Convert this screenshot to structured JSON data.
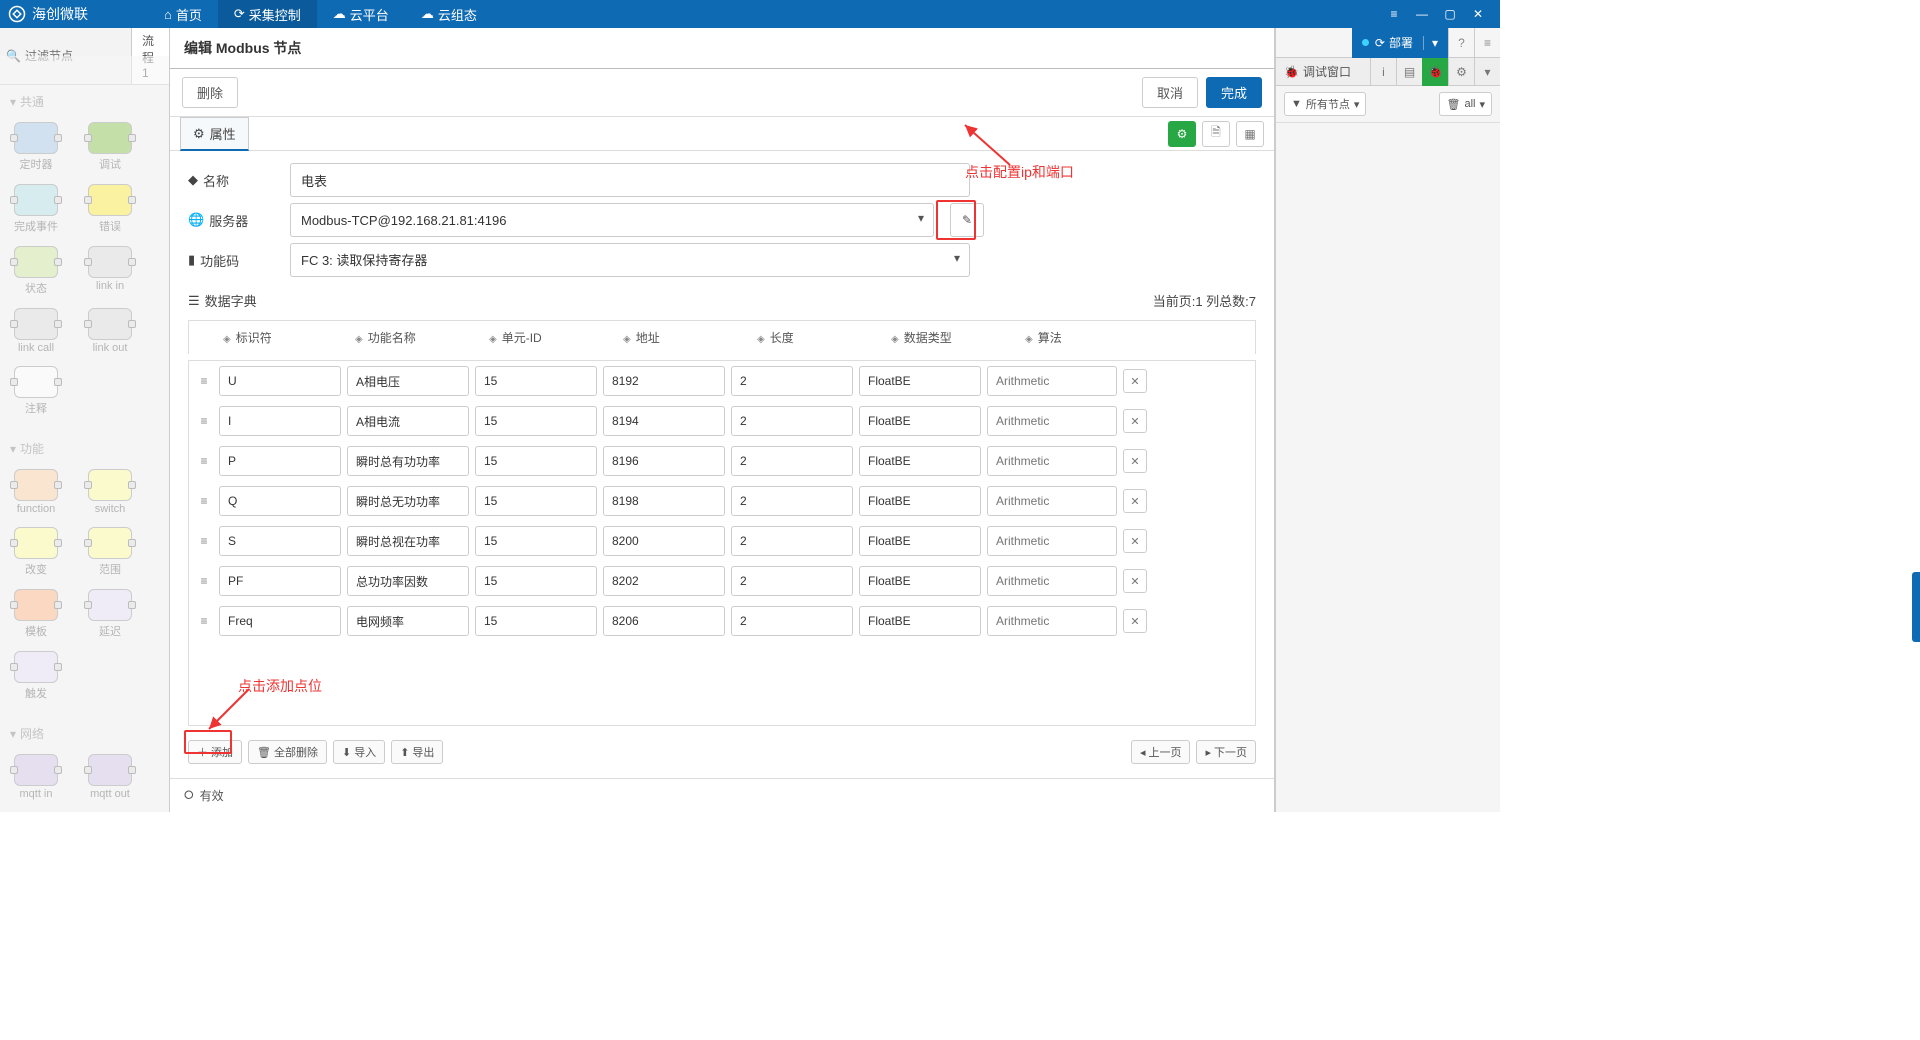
{
  "app_name": "海创微联",
  "top_nav": {
    "home": "首页",
    "collect": "采集控制",
    "cloud_platform": "云平台",
    "cloud_config": "云组态"
  },
  "palette": {
    "filter_placeholder": "过滤节点",
    "flow_tab": "流程1",
    "group_common": "共通",
    "group_function": "功能",
    "group_network": "网络",
    "nodes_common": [
      "定时器",
      "调试",
      "完成事件",
      "错误",
      "状态",
      "link in",
      "link call",
      "link out",
      "注释"
    ],
    "nodes_function": [
      "function",
      "switch",
      "改变",
      "范围",
      "模板",
      "延迟",
      "触发"
    ],
    "nodes_network": [
      "mqtt in",
      "mqtt out"
    ]
  },
  "editor": {
    "title": "编辑 Modbus 节点",
    "delete": "删除",
    "cancel": "取消",
    "done": "完成",
    "tab_props": "属性",
    "label_name": "名称",
    "name_value": "电表",
    "label_server": "服务器",
    "server_value": "Modbus-TCP@192.168.21.81:4196",
    "label_funccode": "功能码",
    "funccode_value": "FC 3: 读取保持寄存器",
    "dict_title": "数据字典",
    "page_info": "当前页:1  列总数:7",
    "columns": {
      "id": "标识符",
      "fn": "功能名称",
      "uid": "单元-ID",
      "addr": "地址",
      "len": "长度",
      "dtype": "数据类型",
      "alg": "算法"
    },
    "alg_placeholder": "Arithmetic",
    "rows": [
      {
        "id": "U",
        "fn": "A相电压",
        "uid": "15",
        "addr": "8192",
        "len": "2",
        "dtype": "FloatBE"
      },
      {
        "id": "I",
        "fn": "A相电流",
        "uid": "15",
        "addr": "8194",
        "len": "2",
        "dtype": "FloatBE"
      },
      {
        "id": "P",
        "fn": "瞬时总有功功率",
        "uid": "15",
        "addr": "8196",
        "len": "2",
        "dtype": "FloatBE"
      },
      {
        "id": "Q",
        "fn": "瞬时总无功功率",
        "uid": "15",
        "addr": "8198",
        "len": "2",
        "dtype": "FloatBE"
      },
      {
        "id": "S",
        "fn": "瞬时总视在功率",
        "uid": "15",
        "addr": "8200",
        "len": "2",
        "dtype": "FloatBE"
      },
      {
        "id": "PF",
        "fn": "总功功率因数",
        "uid": "15",
        "addr": "8202",
        "len": "2",
        "dtype": "FloatBE"
      },
      {
        "id": "Freq",
        "fn": "电网频率",
        "uid": "15",
        "addr": "8206",
        "len": "2",
        "dtype": "FloatBE"
      }
    ],
    "btn_add": "添加",
    "btn_delete_all": "全部删除",
    "btn_import": "导入",
    "btn_export": "导出",
    "btn_prev": "上一页",
    "btn_next": "下一页",
    "footer_valid": "有效"
  },
  "annotations": {
    "config_ip": "点击配置ip和端口",
    "add_point": "点击添加点位"
  },
  "sidebar": {
    "deploy": "部署",
    "debug_panel": "调试窗口",
    "filter_nodes": "所有节点",
    "filter_all": "all"
  },
  "node_colors": {
    "定时器": "#a7c7e7",
    "调试": "#8bc34a",
    "完成事件": "#b0e0e6",
    "错误": "#ffeb3b",
    "状态": "#cde69c",
    "link in": "#dcdcdc",
    "link call": "#dcdcdc",
    "link out": "#dcdcdc",
    "注释": "#ffffff",
    "function": "#fdd0a2",
    "switch": "#ffff99",
    "改变": "#ffff99",
    "范围": "#ffff99",
    "模板": "#ffb380",
    "延迟": "#e6e0f8",
    "触发": "#e6e0f8",
    "mqtt in": "#d1c4e9",
    "mqtt out": "#d1c4e9"
  }
}
